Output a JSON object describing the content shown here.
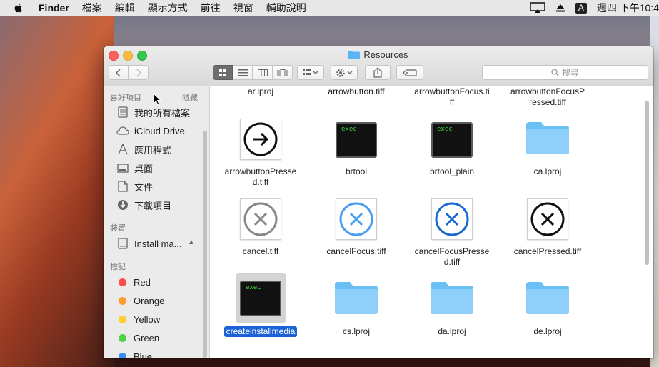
{
  "menubar": {
    "app_name": "Finder",
    "menus": [
      "檔案",
      "編輯",
      "顯示方式",
      "前往",
      "視窗",
      "輔助說明"
    ],
    "input_method": "A",
    "clock": "週四 下午10:4"
  },
  "window": {
    "title": "Resources",
    "search_placeholder": "搜尋"
  },
  "sidebar": {
    "favorites_heading": "喜好項目",
    "hide_label": "隱藏",
    "favorites": [
      {
        "label": "我的所有檔案",
        "icon": "all-files-icon"
      },
      {
        "label": "iCloud Drive",
        "icon": "cloud-icon"
      },
      {
        "label": "應用程式",
        "icon": "applications-icon"
      },
      {
        "label": "桌面",
        "icon": "desktop-icon"
      },
      {
        "label": "文件",
        "icon": "documents-icon"
      },
      {
        "label": "下載項目",
        "icon": "downloads-icon"
      }
    ],
    "devices_heading": "裝置",
    "devices": [
      {
        "label": "Install ma...",
        "icon": "drive-icon"
      }
    ],
    "tags_heading": "標記",
    "tags": [
      {
        "label": "Red",
        "color": "#fc4f4c"
      },
      {
        "label": "Orange",
        "color": "#fd9b2e"
      },
      {
        "label": "Yellow",
        "color": "#fcd12e"
      },
      {
        "label": "Green",
        "color": "#4cd044"
      },
      {
        "label": "Blue",
        "color": "#3a8ef7"
      }
    ]
  },
  "files": {
    "row0": [
      "ar.lproj",
      "arrowbutton.tiff",
      "arrowbuttonFocus.ti\nff",
      "arrowbuttonFocusP\nressed.tiff"
    ],
    "row1": [
      "arrowbuttonPresse\nd.tiff",
      "brtool",
      "brtool_plain",
      "ca.lproj"
    ],
    "row2": [
      "cancel.tiff",
      "cancelFocus.tiff",
      "cancelFocusPresse\nd.tiff",
      "cancelPressed.tiff"
    ],
    "row3": [
      "createinstallmedia",
      "cs.lproj",
      "da.lproj",
      "de.lproj"
    ],
    "exec_text": "exec"
  }
}
